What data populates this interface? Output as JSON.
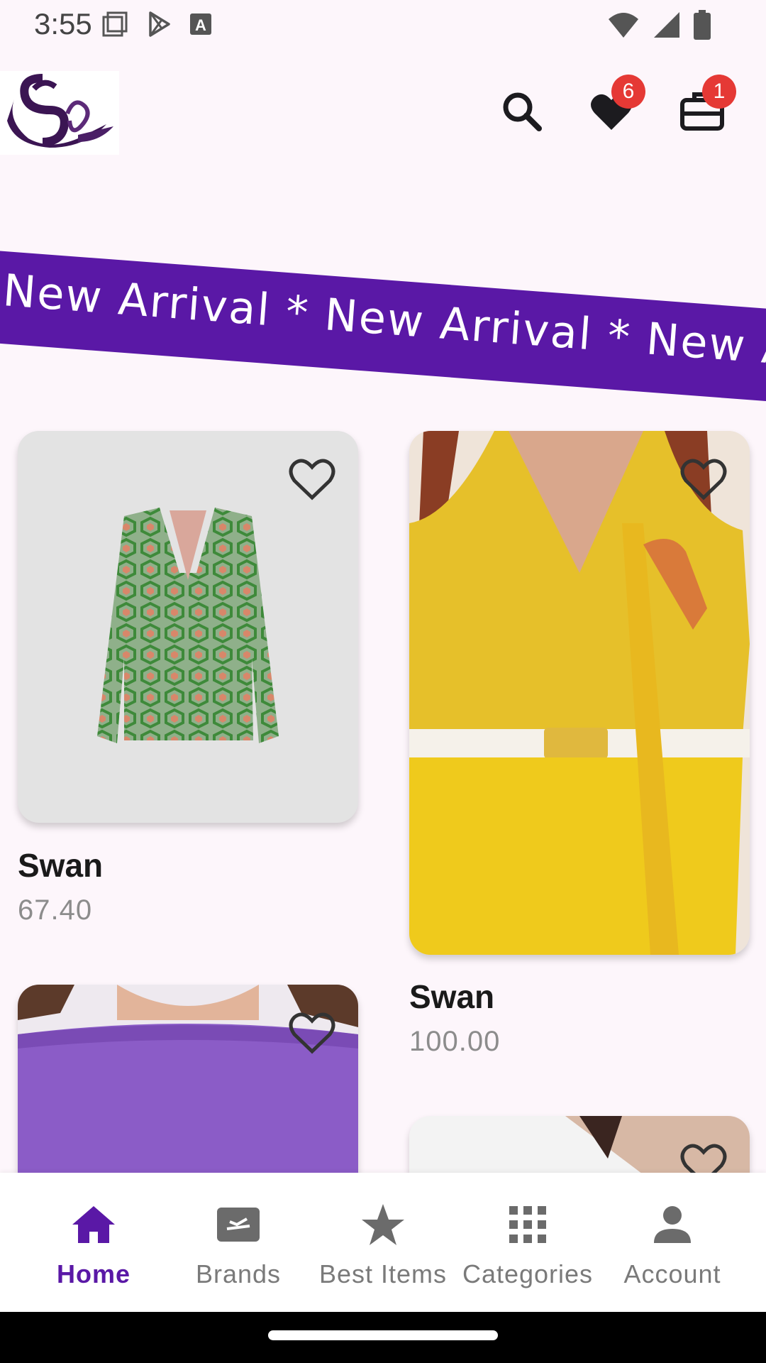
{
  "status_bar": {
    "time": "3:55"
  },
  "header": {
    "wishlist_count": "6",
    "cart_count": "1"
  },
  "banner": {
    "text": "New Arrival * New Arrival * New Arrival * New Arrival"
  },
  "products": [
    {
      "name": "Swan",
      "price": "67.40",
      "image": "green-geometric-blazer"
    },
    {
      "name": "Swan",
      "price": "100.00",
      "image": "yellow-blouse-outfit"
    },
    {
      "name": "",
      "price": "",
      "image": "purple-offshoulder-top"
    },
    {
      "name": "",
      "price": "",
      "image": "white-top"
    }
  ],
  "bottom_nav": [
    {
      "label": "Home",
      "icon": "home-icon",
      "active": true
    },
    {
      "label": "Brands",
      "icon": "flight-ticket-icon"
    },
    {
      "label": "Best Items",
      "icon": "star-icon"
    },
    {
      "label": "Categories",
      "icon": "grid-icon"
    },
    {
      "label": "Account",
      "icon": "person-icon"
    }
  ],
  "colors": {
    "accent": "#5a18a6",
    "badge": "#e53935",
    "background": "#fdf6fb"
  }
}
